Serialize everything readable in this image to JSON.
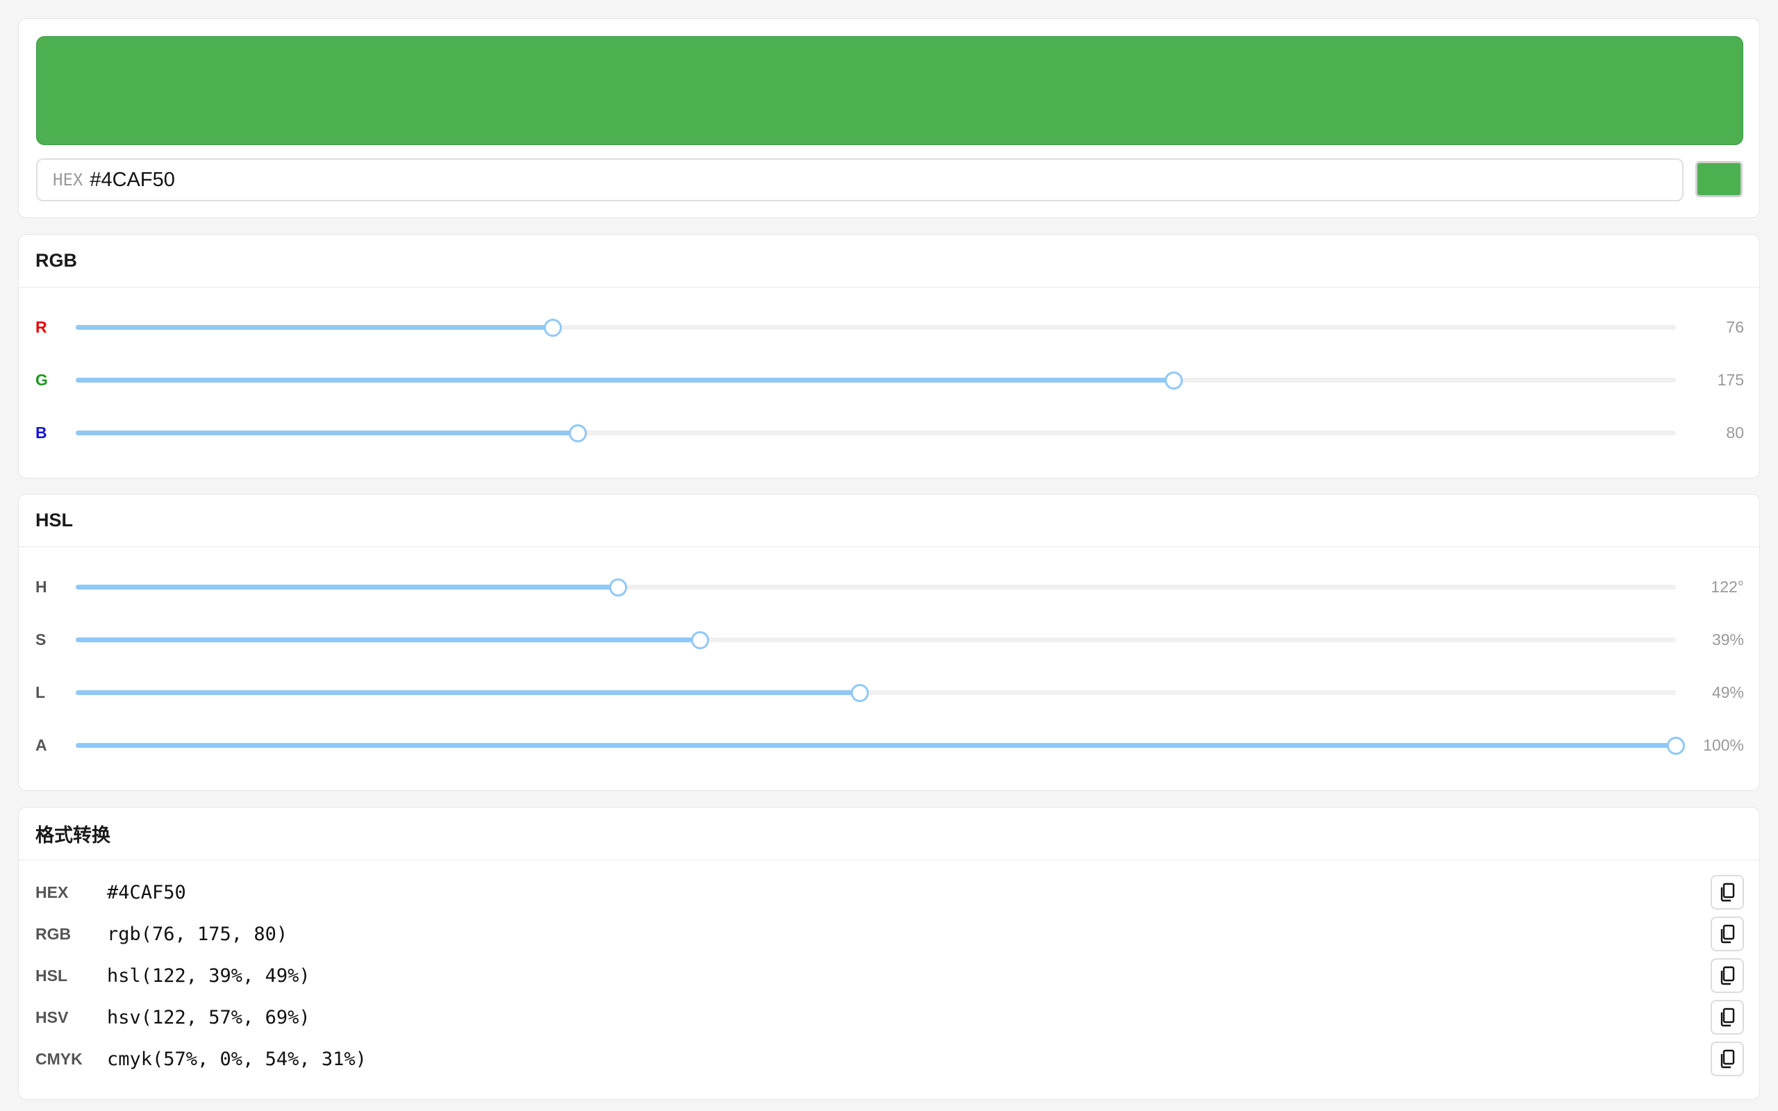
{
  "colors": {
    "current": "#4CAF50",
    "slider_accent": "#90c8f8",
    "label_r": "#e60000",
    "label_g": "#1a9a1a",
    "label_b": "#1414d8"
  },
  "picker": {
    "hex_prefix": "HEX",
    "hex_value": "#4CAF50"
  },
  "rgb": {
    "title": "RGB",
    "sliders": [
      {
        "label": "R",
        "value_text": "76",
        "fraction": 0.298
      },
      {
        "label": "G",
        "value_text": "175",
        "fraction": 0.686
      },
      {
        "label": "B",
        "value_text": "80",
        "fraction": 0.314
      }
    ]
  },
  "hsl": {
    "title": "HSL",
    "sliders": [
      {
        "label": "H",
        "value_text": "122°",
        "fraction": 0.339
      },
      {
        "label": "S",
        "value_text": "39%",
        "fraction": 0.39
      },
      {
        "label": "L",
        "value_text": "49%",
        "fraction": 0.49
      },
      {
        "label": "A",
        "value_text": "100%",
        "fraction": 1.0
      }
    ]
  },
  "formats": {
    "title": "格式转换",
    "copy_icon": "copy-icon",
    "rows": [
      {
        "label": "HEX",
        "value": "#4CAF50"
      },
      {
        "label": "RGB",
        "value": "rgb(76, 175, 80)"
      },
      {
        "label": "HSL",
        "value": "hsl(122, 39%, 49%)"
      },
      {
        "label": "HSV",
        "value": "hsv(122, 57%, 69%)"
      },
      {
        "label": "CMYK",
        "value": "cmyk(57%, 0%, 54%, 31%)"
      }
    ]
  }
}
